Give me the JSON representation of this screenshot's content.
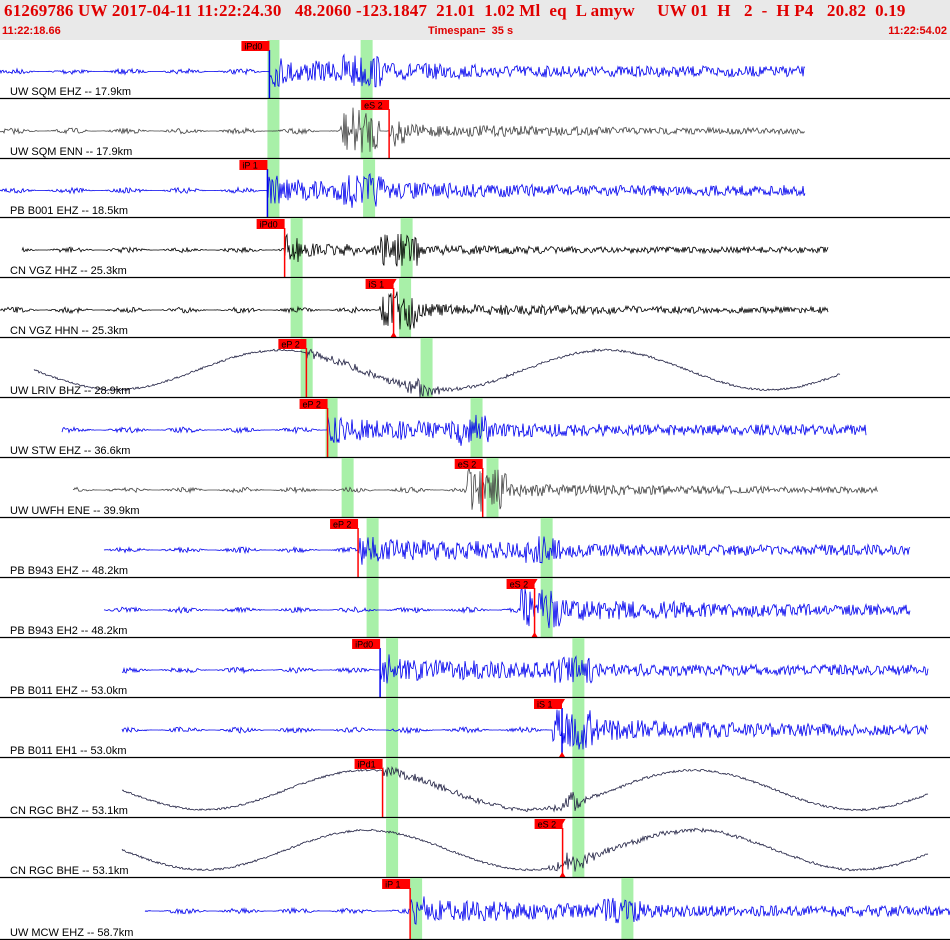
{
  "header": {
    "title": "61269786 UW 2017-04-11 11:22:24.30   48.2060 -123.1847  21.01  1.02 Ml  eq  L amyw     UW 01  H   2  -  H P4   20.82  0.19",
    "start_time": "11:22:18.66",
    "timespan": "Timespan=  35 s",
    "end_time": "11:22:54.02"
  },
  "colors": {
    "blue": "#0000ee",
    "black": "#000000",
    "grey": "#444444",
    "navy": "#222244",
    "pick_flag": "#ff0000",
    "window_band": "#a8f0a8",
    "header_bg": "#e9e9e9",
    "header_text": "#e00000"
  },
  "traces": [
    {
      "label": "UW SQM EHZ -- 17.9km",
      "color": "blue",
      "pick": {
        "label": "iPd0",
        "pos": 0.2836
      },
      "pickline": {
        "pos": 0.2836,
        "color": "blue"
      },
      "bands": [
        0.2815,
        0.3796
      ]
    },
    {
      "label": "UW SQM ENN -- 17.9km",
      "color": "grey",
      "pick": {
        "label": "eS 2",
        "pos": 0.4096
      },
      "pickline": {
        "pos": 0.4096,
        "color": "red"
      },
      "bands": [
        0.2815,
        0.3796
      ]
    },
    {
      "label": "PB B001 EHZ -- 18.5km",
      "color": "blue",
      "pick": {
        "label": "iP 1",
        "pos": 0.2815
      },
      "pickline": {
        "pos": 0.2815,
        "color": "blue"
      },
      "bands": [
        0.2815,
        0.3822
      ]
    },
    {
      "label": "CN VGZ HHZ -- 25.3km",
      "color": "black",
      "pick": {
        "label": "iPd0",
        "pos": 0.2996
      },
      "pickline": {
        "pos": 0.2996,
        "color": "red"
      },
      "bands": [
        0.3059,
        0.4217
      ]
    },
    {
      "label": "CN VGZ HHN -- 25.3km",
      "color": "black",
      "pick": {
        "label": "iS 1",
        "pos": 0.4143,
        "tri": true
      },
      "pickline": {
        "pos": 0.4143,
        "color": "red"
      },
      "bands": [
        0.3059,
        0.4201
      ]
    },
    {
      "label": "UW LRIV BHZ -- 28.9km",
      "color": "navy",
      "pick": {
        "label": "eP 2",
        "pos": 0.3225
      },
      "pickline": {
        "pos": 0.3225,
        "color": "red"
      },
      "bands": [
        0.3165,
        0.4427
      ]
    },
    {
      "label": "UW STW EHZ -- 36.6km",
      "color": "blue",
      "pick": {
        "label": "eP 2",
        "pos": 0.3448
      },
      "pickline": {
        "pos": 0.3448,
        "color": "red"
      },
      "bands": [
        0.3427,
        0.4953
      ]
    },
    {
      "label": "UW UWFH ENE -- 39.9km",
      "color": "grey",
      "pick": {
        "label": "eS 2",
        "pos": 0.5081
      },
      "pickline": {
        "pos": 0.5081,
        "color": "red"
      },
      "bands": [
        0.3596,
        0.5121
      ]
    },
    {
      "label": "PB B943 EHZ -- 48.2km",
      "color": "blue",
      "pick": {
        "label": "eP 2",
        "pos": 0.3769
      },
      "pickline": {
        "pos": 0.3769,
        "color": "red"
      },
      "bands": [
        0.3859,
        0.5691
      ]
    },
    {
      "label": "PB B943 EH2 -- 48.2km",
      "color": "blue",
      "pick": {
        "label": "eS 2",
        "pos": 0.5627,
        "tri": true
      },
      "pickline": {
        "pos": 0.5627,
        "color": "red"
      },
      "bands": [
        0.3859,
        0.5691
      ]
    },
    {
      "label": "PB B011 EHZ -- 53.0km",
      "color": "blue",
      "pick": {
        "label": "iPd0",
        "pos": 0.4001
      },
      "pickline": {
        "pos": 0.4001,
        "color": "blue"
      },
      "bands": [
        0.4064,
        0.6025
      ]
    },
    {
      "label": "PB B011 EH1 -- 53.0km",
      "color": "blue",
      "pick": {
        "label": "iS 1",
        "pos": 0.5916,
        "tri": true
      },
      "pickline": {
        "pos": 0.5916,
        "color": "blue"
      },
      "bands": [
        0.4064,
        0.6025
      ]
    },
    {
      "label": "CN RGC BHZ -- 53.1km",
      "color": "navy",
      "pick": {
        "label": "iPd1",
        "pos": 0.4027
      },
      "pickline": {
        "pos": 0.4027,
        "color": "red"
      },
      "bands": [
        0.4064,
        0.6025
      ]
    },
    {
      "label": "CN RGC BHE -- 53.1km",
      "color": "navy",
      "pick": {
        "label": "eS 2",
        "pos": 0.5922,
        "tri": true
      },
      "pickline": {
        "pos": 0.5922,
        "color": "red"
      },
      "bands": [
        0.4064,
        0.6025
      ]
    },
    {
      "label": "UW MCW EHZ -- 58.7km",
      "color": "blue",
      "pick": {
        "label": "iP 1",
        "pos": 0.4317
      },
      "pickline": {
        "pos": 0.4317,
        "color": "red"
      },
      "bands": [
        0.4317,
        0.6541
      ]
    }
  ]
}
